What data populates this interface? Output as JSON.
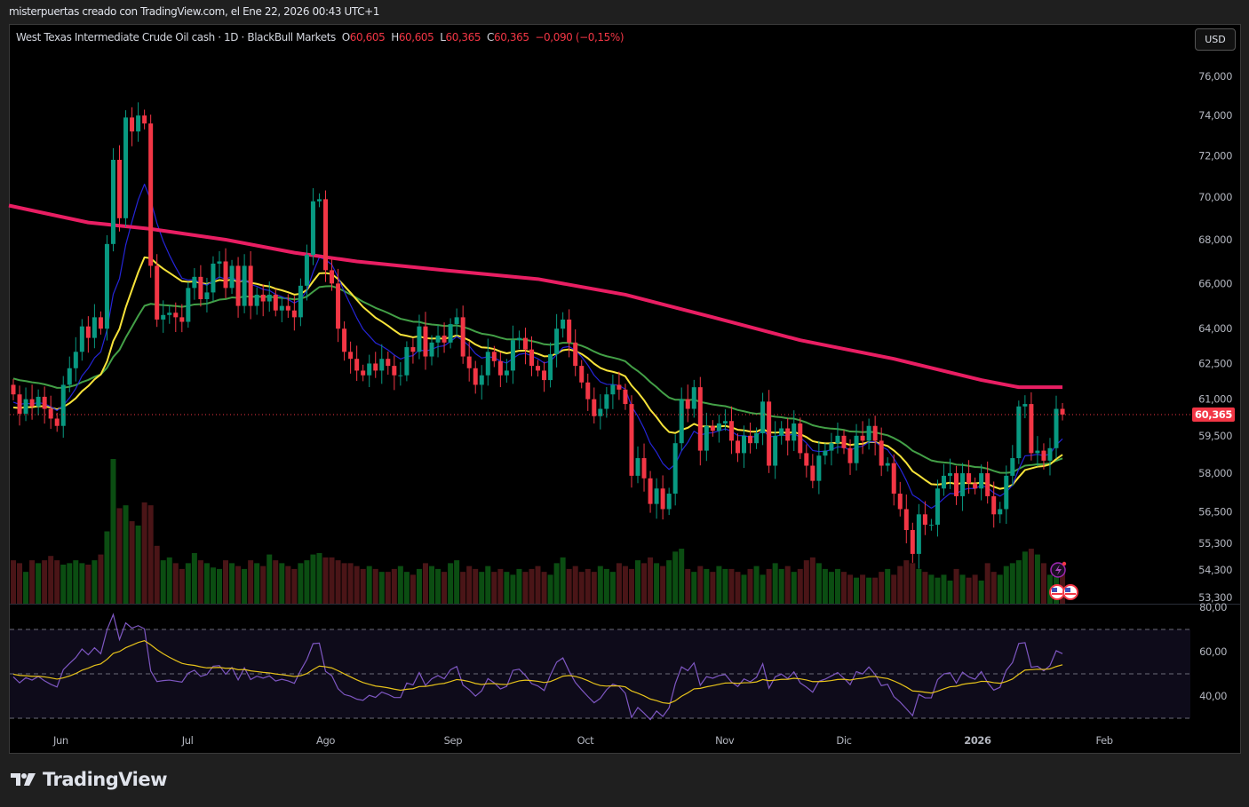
{
  "credit": "misterpuertas creado con TradingView.com, el Ene 22, 2026 00:43 UTC+1",
  "legend": {
    "symbol": "West Texas Intermediate Crude Oil cash · 1D · BlackBull Markets",
    "o_label": "O",
    "o": "60,605",
    "h_label": "H",
    "h": "60,605",
    "l_label": "L",
    "l": "60,365",
    "c_label": "C",
    "c": "60,365",
    "change": "−0,090 (−0,15%)"
  },
  "currency_button": "USD",
  "last_price_label": "60,365",
  "brand": "TradingView",
  "colors": {
    "up": "#089981",
    "down": "#f23645",
    "vol_up": "#0b4d12",
    "vol_down": "#4a1517",
    "ema_fast": "#2525d8",
    "ema_mid": "#f7e33a",
    "ema_slow": "#43a047",
    "ma200": "#e91e63",
    "rsi": "#7e57c2",
    "rsi_ma": "#e6c21a"
  },
  "icons": [
    "lightning-event-icon",
    "us-flag-event-icon",
    "us-flag-event-icon"
  ],
  "chart_data": {
    "type": "candlestick",
    "title": "West Texas Intermediate Crude Oil cash · 1D",
    "scale": "log",
    "ylim": [
      53.0,
      77.0
    ],
    "price_ticks": [
      {
        "v": 76.0,
        "label": "76,000"
      },
      {
        "v": 74.0,
        "label": "74,000"
      },
      {
        "v": 72.0,
        "label": "72,000"
      },
      {
        "v": 70.0,
        "label": "70,000"
      },
      {
        "v": 68.0,
        "label": "68,000"
      },
      {
        "v": 66.0,
        "label": "66,000"
      },
      {
        "v": 64.0,
        "label": "64,000"
      },
      {
        "v": 62.5,
        "label": "62,500"
      },
      {
        "v": 61.0,
        "label": "61,000"
      },
      {
        "v": 59.5,
        "label": "59,500"
      },
      {
        "v": 58.0,
        "label": "58,000"
      },
      {
        "v": 56.5,
        "label": "56,500"
      },
      {
        "v": 55.3,
        "label": "55,300"
      },
      {
        "v": 54.3,
        "label": "54,300"
      },
      {
        "v": 53.3,
        "label": "53,300"
      }
    ],
    "time_ticks": [
      {
        "i": 7.6,
        "label": "Jun"
      },
      {
        "i": 27.9,
        "label": "Jul"
      },
      {
        "i": 50,
        "label": "Ago"
      },
      {
        "i": 70.4,
        "label": "Sep"
      },
      {
        "i": 91.6,
        "label": "Oct"
      },
      {
        "i": 113.9,
        "label": "Nov"
      },
      {
        "i": 133,
        "label": "Dic"
      },
      {
        "i": 154.4,
        "label": "2026",
        "bold": true
      },
      {
        "i": 174.7,
        "label": "Feb"
      }
    ],
    "last_price": 60.365,
    "close": [
      61.2,
      60.4,
      61.0,
      60.7,
      61.1,
      60.6,
      60.2,
      59.9,
      61.6,
      62.3,
      63.0,
      64.1,
      63.6,
      64.5,
      64.0,
      67.8,
      71.8,
      69.0,
      73.9,
      73.2,
      74.0,
      73.6,
      66.8,
      64.4,
      64.6,
      64.7,
      64.5,
      64.3,
      65.8,
      66.3,
      65.3,
      65.6,
      66.9,
      67.0,
      65.8,
      66.8,
      65.0,
      66.8,
      65.0,
      65.5,
      65.2,
      65.5,
      64.8,
      65.0,
      64.8,
      64.5,
      65.9,
      67.3,
      69.8,
      69.9,
      66.6,
      66.0,
      64.0,
      63.0,
      62.7,
      62.2,
      62.0,
      62.5,
      62.2,
      62.7,
      62.4,
      62.0,
      62.0,
      63.2,
      63.0,
      64.1,
      62.8,
      63.4,
      63.7,
      63.4,
      64.2,
      64.5,
      62.8,
      62.3,
      61.6,
      62.0,
      63.0,
      62.6,
      62.0,
      62.2,
      63.5,
      63.6,
      63.1,
      62.4,
      62.2,
      61.8,
      62.9,
      64.0,
      64.4,
      63.4,
      62.4,
      61.7,
      61.0,
      60.3,
      60.6,
      61.2,
      61.6,
      61.4,
      60.8,
      57.9,
      58.6,
      57.8,
      56.8,
      57.4,
      56.6,
      57.2,
      59.2,
      61.0,
      60.6,
      61.5,
      58.9,
      59.9,
      59.7,
      60.0,
      60.1,
      59.3,
      58.8,
      59.5,
      59.2,
      59.6,
      60.9,
      58.3,
      59.5,
      59.8,
      59.3,
      60.0,
      58.8,
      58.3,
      57.7,
      58.7,
      58.9,
      59.2,
      59.5,
      59.0,
      58.4,
      59.5,
      59.3,
      59.9,
      59.3,
      58.3,
      58.4,
      57.2,
      56.6,
      55.8,
      54.9,
      56.4,
      56.0,
      56.0,
      57.4,
      57.9,
      58.0,
      57.1,
      58.0,
      57.6,
      57.4,
      58.0,
      57.1,
      56.4,
      56.6,
      57.9,
      58.6,
      60.7,
      60.8,
      58.8,
      58.9,
      58.5,
      59.0,
      60.6,
      60.365
    ],
    "first_open": 61.6,
    "volume": [
      30,
      28,
      22,
      30,
      28,
      30,
      33,
      30,
      27,
      28,
      30,
      28,
      27,
      30,
      34,
      50,
      100,
      66,
      68,
      57,
      54,
      70,
      68,
      40,
      30,
      32,
      28,
      24,
      28,
      35,
      30,
      28,
      25,
      24,
      30,
      28,
      26,
      24,
      30,
      28,
      26,
      34,
      30,
      28,
      26,
      24,
      28,
      30,
      34,
      35,
      32,
      32,
      30,
      28,
      28,
      26,
      24,
      26,
      24,
      22,
      22,
      24,
      26,
      22,
      20,
      24,
      28,
      26,
      24,
      22,
      28,
      30,
      22,
      26,
      24,
      22,
      26,
      22,
      24,
      22,
      20,
      24,
      22,
      24,
      26,
      22,
      20,
      28,
      32,
      24,
      26,
      22,
      24,
      22,
      26,
      24,
      22,
      28,
      26,
      24,
      30,
      28,
      32,
      28,
      26,
      30,
      36,
      38,
      24,
      22,
      26,
      24,
      22,
      26,
      24,
      24,
      22,
      20,
      24,
      26,
      20,
      24,
      28,
      24,
      26,
      22,
      24,
      30,
      32,
      28,
      24,
      22,
      24,
      22,
      20,
      18,
      20,
      18,
      18,
      22,
      24,
      20,
      26,
      30,
      28,
      24,
      22,
      20,
      18,
      20,
      16,
      24,
      20,
      18,
      20,
      16,
      28,
      22,
      20,
      26,
      28,
      30,
      36,
      38,
      34,
      28,
      20,
      26,
      24
    ],
    "ma_seeds": {
      "ema_fast": 60.8,
      "ema_mid": 60.6,
      "ema_slow": 61.9
    },
    "ma200": [
      {
        "i": 0,
        "v": 69.6
      },
      {
        "i": 12,
        "v": 68.8
      },
      {
        "i": 22,
        "v": 68.5
      },
      {
        "i": 34,
        "v": 68.0
      },
      {
        "i": 45,
        "v": 67.4
      },
      {
        "i": 55,
        "v": 67.0
      },
      {
        "i": 69,
        "v": 66.6
      },
      {
        "i": 84,
        "v": 66.2
      },
      {
        "i": 98,
        "v": 65.5
      },
      {
        "i": 112,
        "v": 64.5
      },
      {
        "i": 126,
        "v": 63.5
      },
      {
        "i": 141,
        "v": 62.7
      },
      {
        "i": 155,
        "v": 61.8
      },
      {
        "i": 161,
        "v": 61.5
      },
      {
        "i": 168,
        "v": 61.5
      }
    ],
    "rsi": {
      "ticks": [
        {
          "v": 80,
          "label": "80,00"
        },
        {
          "v": 60,
          "label": "60,00"
        },
        {
          "v": 40,
          "label": "40,00"
        }
      ],
      "bands": [
        70,
        50,
        30
      ],
      "period": 14,
      "ma_period": 14
    }
  }
}
